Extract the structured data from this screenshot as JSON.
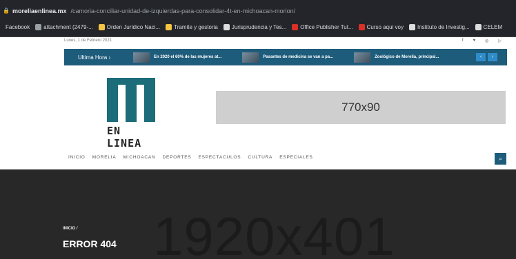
{
  "browser": {
    "url_host": "moreliaenlinea.mx",
    "url_path": "/camoria-conciliar-unidad-de-izquierdas-para-consolidar-4t-en-michoacan-morion/"
  },
  "bookmarks": [
    {
      "label": "Facebook",
      "color": "#1877f2"
    },
    {
      "label": "attachment (2479-...",
      "color": "#9aa0a6"
    },
    {
      "label": "Orden Jurídico Naci...",
      "color": "#f5c542"
    },
    {
      "label": "Tramite y gestoria",
      "color": "#f5c542"
    },
    {
      "label": "Jurisprudencia y Tes...",
      "color": "#dddddd"
    },
    {
      "label": "Office Publisher Tut...",
      "color": "#d93025"
    },
    {
      "label": "Curso aqui voy",
      "color": "#d93025"
    },
    {
      "label": "Instituto de Investig...",
      "color": "#dddddd"
    },
    {
      "label": "CELEM",
      "color": "#dddddd"
    }
  ],
  "date": "Lunes, 1 de Febrero 2021",
  "social_icons": [
    "facebook-icon",
    "twitter-icon",
    "instagram-icon",
    "youtube-icon"
  ],
  "breaking": {
    "label": "Ultima Hora  ›",
    "items": [
      "En 2020 el 60% de las mujeres at...",
      "Pasantes de medicina se van a pa...",
      "Zoológico de Morelia, principal..."
    ],
    "prev": "‹",
    "next": "›"
  },
  "logo": {
    "wordmark": "EN LINEA"
  },
  "ad": {
    "text": "770x90"
  },
  "nav": [
    "INICIO",
    "MORELIA",
    "MICHOACAN",
    "DEPORTES",
    "ESPECTACULOS",
    "CULTURA",
    "ESPECIALES"
  ],
  "search_icon": "search-icon",
  "hero": {
    "placeholder": "1920x401",
    "breadcrumb": "INICIO  ⁄",
    "title": "ERROR 404"
  },
  "colors": {
    "brand": "#1e5c7b",
    "logo": "#1c6c79",
    "hero_bg": "#282828"
  }
}
